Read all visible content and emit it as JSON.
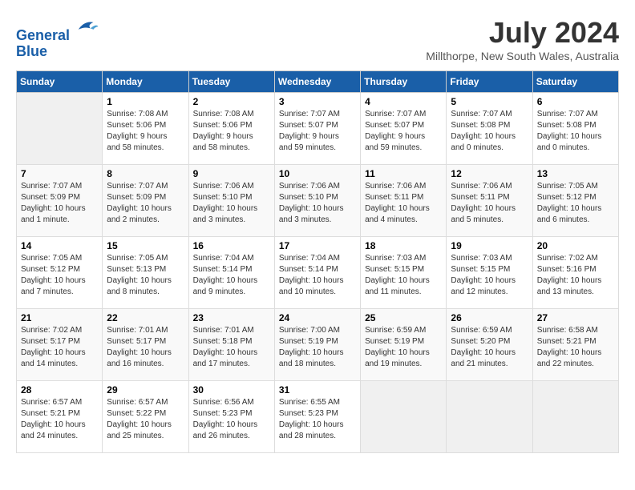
{
  "header": {
    "logo_line1": "General",
    "logo_line2": "Blue",
    "month_title": "July 2024",
    "location": "Millthorpe, New South Wales, Australia"
  },
  "days_of_week": [
    "Sunday",
    "Monday",
    "Tuesday",
    "Wednesday",
    "Thursday",
    "Friday",
    "Saturday"
  ],
  "weeks": [
    [
      {
        "day": "",
        "info": ""
      },
      {
        "day": "1",
        "info": "Sunrise: 7:08 AM\nSunset: 5:06 PM\nDaylight: 9 hours\nand 58 minutes."
      },
      {
        "day": "2",
        "info": "Sunrise: 7:08 AM\nSunset: 5:06 PM\nDaylight: 9 hours\nand 58 minutes."
      },
      {
        "day": "3",
        "info": "Sunrise: 7:07 AM\nSunset: 5:07 PM\nDaylight: 9 hours\nand 59 minutes."
      },
      {
        "day": "4",
        "info": "Sunrise: 7:07 AM\nSunset: 5:07 PM\nDaylight: 9 hours\nand 59 minutes."
      },
      {
        "day": "5",
        "info": "Sunrise: 7:07 AM\nSunset: 5:08 PM\nDaylight: 10 hours\nand 0 minutes."
      },
      {
        "day": "6",
        "info": "Sunrise: 7:07 AM\nSunset: 5:08 PM\nDaylight: 10 hours\nand 0 minutes."
      }
    ],
    [
      {
        "day": "7",
        "info": "Sunrise: 7:07 AM\nSunset: 5:09 PM\nDaylight: 10 hours\nand 1 minute."
      },
      {
        "day": "8",
        "info": "Sunrise: 7:07 AM\nSunset: 5:09 PM\nDaylight: 10 hours\nand 2 minutes."
      },
      {
        "day": "9",
        "info": "Sunrise: 7:06 AM\nSunset: 5:10 PM\nDaylight: 10 hours\nand 3 minutes."
      },
      {
        "day": "10",
        "info": "Sunrise: 7:06 AM\nSunset: 5:10 PM\nDaylight: 10 hours\nand 3 minutes."
      },
      {
        "day": "11",
        "info": "Sunrise: 7:06 AM\nSunset: 5:11 PM\nDaylight: 10 hours\nand 4 minutes."
      },
      {
        "day": "12",
        "info": "Sunrise: 7:06 AM\nSunset: 5:11 PM\nDaylight: 10 hours\nand 5 minutes."
      },
      {
        "day": "13",
        "info": "Sunrise: 7:05 AM\nSunset: 5:12 PM\nDaylight: 10 hours\nand 6 minutes."
      }
    ],
    [
      {
        "day": "14",
        "info": "Sunrise: 7:05 AM\nSunset: 5:12 PM\nDaylight: 10 hours\nand 7 minutes."
      },
      {
        "day": "15",
        "info": "Sunrise: 7:05 AM\nSunset: 5:13 PM\nDaylight: 10 hours\nand 8 minutes."
      },
      {
        "day": "16",
        "info": "Sunrise: 7:04 AM\nSunset: 5:14 PM\nDaylight: 10 hours\nand 9 minutes."
      },
      {
        "day": "17",
        "info": "Sunrise: 7:04 AM\nSunset: 5:14 PM\nDaylight: 10 hours\nand 10 minutes."
      },
      {
        "day": "18",
        "info": "Sunrise: 7:03 AM\nSunset: 5:15 PM\nDaylight: 10 hours\nand 11 minutes."
      },
      {
        "day": "19",
        "info": "Sunrise: 7:03 AM\nSunset: 5:15 PM\nDaylight: 10 hours\nand 12 minutes."
      },
      {
        "day": "20",
        "info": "Sunrise: 7:02 AM\nSunset: 5:16 PM\nDaylight: 10 hours\nand 13 minutes."
      }
    ],
    [
      {
        "day": "21",
        "info": "Sunrise: 7:02 AM\nSunset: 5:17 PM\nDaylight: 10 hours\nand 14 minutes."
      },
      {
        "day": "22",
        "info": "Sunrise: 7:01 AM\nSunset: 5:17 PM\nDaylight: 10 hours\nand 16 minutes."
      },
      {
        "day": "23",
        "info": "Sunrise: 7:01 AM\nSunset: 5:18 PM\nDaylight: 10 hours\nand 17 minutes."
      },
      {
        "day": "24",
        "info": "Sunrise: 7:00 AM\nSunset: 5:19 PM\nDaylight: 10 hours\nand 18 minutes."
      },
      {
        "day": "25",
        "info": "Sunrise: 6:59 AM\nSunset: 5:19 PM\nDaylight: 10 hours\nand 19 minutes."
      },
      {
        "day": "26",
        "info": "Sunrise: 6:59 AM\nSunset: 5:20 PM\nDaylight: 10 hours\nand 21 minutes."
      },
      {
        "day": "27",
        "info": "Sunrise: 6:58 AM\nSunset: 5:21 PM\nDaylight: 10 hours\nand 22 minutes."
      }
    ],
    [
      {
        "day": "28",
        "info": "Sunrise: 6:57 AM\nSunset: 5:21 PM\nDaylight: 10 hours\nand 24 minutes."
      },
      {
        "day": "29",
        "info": "Sunrise: 6:57 AM\nSunset: 5:22 PM\nDaylight: 10 hours\nand 25 minutes."
      },
      {
        "day": "30",
        "info": "Sunrise: 6:56 AM\nSunset: 5:23 PM\nDaylight: 10 hours\nand 26 minutes."
      },
      {
        "day": "31",
        "info": "Sunrise: 6:55 AM\nSunset: 5:23 PM\nDaylight: 10 hours\nand 28 minutes."
      },
      {
        "day": "",
        "info": ""
      },
      {
        "day": "",
        "info": ""
      },
      {
        "day": "",
        "info": ""
      }
    ]
  ]
}
